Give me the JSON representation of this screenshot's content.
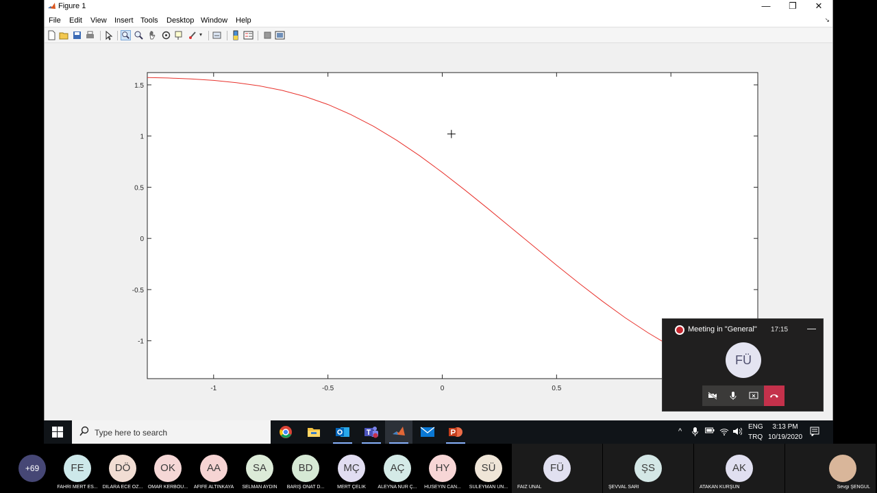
{
  "figure_window": {
    "title": "Figure 1",
    "minimize_glyph": "—",
    "restore_glyph": "❐",
    "close_glyph": "✕",
    "menus": [
      "File",
      "Edit",
      "View",
      "Insert",
      "Tools",
      "Desktop",
      "Window",
      "Help"
    ],
    "toolbar_icons": [
      "new-figure-icon",
      "open-file-icon",
      "save-icon",
      "print-icon",
      "edit-plot-icon",
      "zoom-in-icon",
      "zoom-out-icon",
      "pan-icon",
      "rotate-3d-icon",
      "data-cursor-icon",
      "brush-icon",
      "link-plot-icon",
      "colorbar-icon",
      "legend-icon",
      "hide-plot-tools-icon",
      "show-plot-tools-icon"
    ]
  },
  "chart_data": {
    "type": "line",
    "title": "",
    "xlabel": "",
    "ylabel": "",
    "xlim": [
      -1.29,
      1.38
    ],
    "ylim": [
      -1.37,
      1.62
    ],
    "x_ticks": [
      -1,
      -0.5,
      0,
      0.5,
      1
    ],
    "x_tick_labels": [
      "-1",
      "-0.5",
      "0",
      "0.5",
      "1"
    ],
    "y_ticks": [
      -1,
      -0.5,
      0,
      0.5,
      1,
      1.5
    ],
    "y_tick_labels": [
      "-1",
      "-0.5",
      "0",
      "0.5",
      "1",
      "1.5"
    ],
    "grid": false,
    "line_color": "#e8302a",
    "series": [
      {
        "name": "",
        "x": [
          -1.29,
          -1.2,
          -1.1,
          -1.0,
          -0.9,
          -0.8,
          -0.7,
          -0.6,
          -0.5,
          -0.4,
          -0.3,
          -0.2,
          -0.1,
          0.0,
          0.1,
          0.2,
          0.3,
          0.4,
          0.5,
          0.6,
          0.7,
          0.8,
          0.9,
          1.0,
          1.05,
          1.1,
          1.2
        ],
        "y": [
          1.571,
          1.567,
          1.558,
          1.544,
          1.522,
          1.49,
          1.446,
          1.386,
          1.308,
          1.21,
          1.094,
          0.96,
          0.809,
          0.645,
          0.471,
          0.291,
          0.107,
          -0.078,
          -0.262,
          -0.441,
          -0.613,
          -0.775,
          -0.922,
          -1.055,
          -1.116,
          -1.175,
          -1.28
        ]
      }
    ],
    "cursor_marker": {
      "x": 0.04,
      "y": 1.02
    }
  },
  "meeting": {
    "title": "Meeting in \"General\"",
    "time": "17:15",
    "minimize_glyph": "—",
    "avatar_initials": "FÜ",
    "record_color": "#c4262e",
    "hangup_color": "#c4314b"
  },
  "taskbar": {
    "search_placeholder": "Type here to search",
    "apps": [
      "chrome-icon",
      "file-explorer-icon",
      "outlook-icon",
      "teams-icon",
      "matlab-icon",
      "mail-icon",
      "powerpoint-icon"
    ],
    "tray_chevron": "^",
    "lang_line1": "ENG",
    "lang_line2": "TRQ",
    "clock_time": "3:13 PM",
    "clock_date": "10/19/2020"
  },
  "participants": {
    "more_count": "+69",
    "people": [
      {
        "initials": "FE",
        "name": "FAHRİ MERT ES...",
        "color": "#cde8ea"
      },
      {
        "initials": "DÖ",
        "name": "DİLARA ECE ÖZ...",
        "color": "#f1ddd3"
      },
      {
        "initials": "OK",
        "name": "OMAR KERBOU...",
        "color": "#f5d7d6"
      },
      {
        "initials": "AA",
        "name": "AFİFE ALTINKAYA",
        "color": "#f6d4d3"
      },
      {
        "initials": "SA",
        "name": "SELMAN AYDIN",
        "color": "#dcebd8"
      },
      {
        "initials": "BD",
        "name": "BARIŞ ONAT D...",
        "color": "#d6e9d5"
      },
      {
        "initials": "MÇ",
        "name": "MERT ÇELİK",
        "color": "#e1ddf1"
      },
      {
        "initials": "AÇ",
        "name": "ALEYNA NUR Ç...",
        "color": "#d4eae7"
      },
      {
        "initials": "HY",
        "name": "HÜSEYİN CAN...",
        "color": "#f7d6d6"
      },
      {
        "initials": "SÜ",
        "name": "SÜLEYMAN ÜN...",
        "color": "#efe5d7"
      }
    ],
    "big": [
      {
        "initials": "FÜ",
        "name": "FAİZ ÜNAL",
        "color": "#e1e0f0"
      },
      {
        "initials": "ŞS",
        "name": "ŞEVVAL SARI",
        "color": "#d4e7e6"
      },
      {
        "initials": "AK",
        "name": "ATAKAN KURŞUN",
        "color": "#e0dff0"
      },
      {
        "initials": "",
        "name": "Sevgi ŞENGÜL",
        "color": "#d9b69a"
      }
    ]
  }
}
